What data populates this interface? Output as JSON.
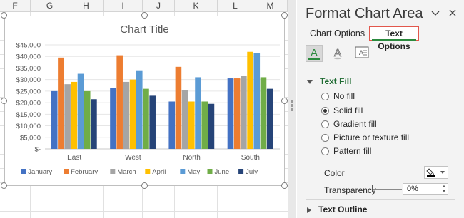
{
  "sheet": {
    "columns": [
      "F",
      "G",
      "H",
      "I",
      "J",
      "K",
      "L",
      "M"
    ]
  },
  "chart_data": {
    "type": "bar",
    "title": "Chart Title",
    "categories": [
      "East",
      "West",
      "North",
      "South"
    ],
    "y_ticks": [
      "$45,000",
      "$40,000",
      "$35,000",
      "$30,000",
      "$25,000",
      "$20,000",
      "$15,000",
      "$10,000",
      "$5,000",
      "$-"
    ],
    "ylim": [
      0,
      45000
    ],
    "grid": true,
    "legend_position": "bottom",
    "series": [
      {
        "name": "January",
        "color": "#4472c4",
        "values": [
          25000,
          26500,
          20500,
          30500
        ]
      },
      {
        "name": "February",
        "color": "#ed7d31",
        "values": [
          39500,
          40500,
          35500,
          30500
        ]
      },
      {
        "name": "March",
        "color": "#a5a5a5",
        "values": [
          28000,
          29000,
          25500,
          31500
        ]
      },
      {
        "name": "April",
        "color": "#ffc000",
        "values": [
          29000,
          30000,
          20500,
          42000
        ]
      },
      {
        "name": "May",
        "color": "#5b9bd5",
        "values": [
          32500,
          34000,
          31000,
          41500
        ]
      },
      {
        "name": "June",
        "color": "#70ad47",
        "values": [
          25000,
          26000,
          20500,
          31000
        ]
      },
      {
        "name": "July",
        "color": "#264478",
        "values": [
          21500,
          23000,
          19500,
          26000
        ]
      }
    ]
  },
  "pane": {
    "title": "Format Chart Area",
    "collapse_icon": "chevron-down-icon",
    "close_icon": "close-icon",
    "tabs": {
      "chart_options": "Chart Options",
      "text_options": "Text Options"
    },
    "icon_tabs": [
      "text-fill-outline-icon",
      "text-effects-icon",
      "textbox-icon"
    ],
    "text_fill": {
      "heading": "Text Fill",
      "options": [
        "No fill",
        "Solid fill",
        "Gradient fill",
        "Picture or texture fill",
        "Pattern fill"
      ],
      "selected": "Solid fill",
      "color_label": "Color",
      "transparency_label": "Transparency",
      "transparency_value": "0%"
    },
    "text_outline": {
      "heading": "Text Outline"
    },
    "accent_color": "#2b8a3e",
    "highlight_color": "#e2574c"
  }
}
